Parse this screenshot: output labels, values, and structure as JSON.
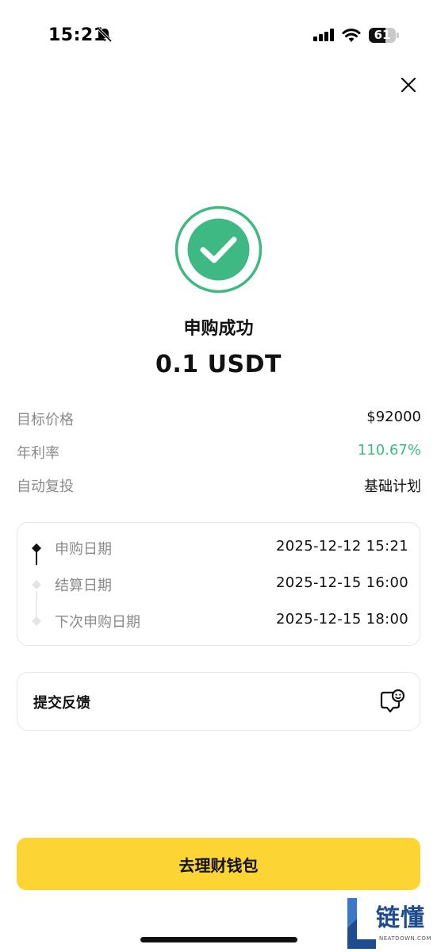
{
  "status_bar": {
    "time": "15:21",
    "battery_text": "61",
    "battery_level": 0.61,
    "icons": [
      "bell-slash-icon",
      "cellular-signal-icon",
      "wifi-icon",
      "battery-icon"
    ]
  },
  "header": {
    "close_icon": "close-icon"
  },
  "result": {
    "icon": "check-circle-icon",
    "title": "申购成功",
    "amount": "0.1 USDT"
  },
  "details": [
    {
      "label": "目标价格",
      "value": "$92000"
    },
    {
      "label": "年利率",
      "value": "110.67%"
    },
    {
      "label": "自动复投",
      "value": "基础计划"
    }
  ],
  "timeline": [
    {
      "label": "申购日期",
      "value": "2025-12-12 15:21",
      "active": true
    },
    {
      "label": "结算日期",
      "value": "2025-12-15 16:00",
      "active": false
    },
    {
      "label": "下次申购日期",
      "value": "2025-12-15 18:00",
      "active": false
    }
  ],
  "feedback": {
    "label": "提交反馈",
    "icon": "feedback-smile-icon"
  },
  "primary_button": {
    "label": "去理财钱包"
  },
  "watermark": {
    "text": "链懂",
    "sub": "NEATDOWN.COM"
  },
  "colors": {
    "accent_yellow": "#fcd535",
    "success_green": "#3fb983",
    "muted_text": "#8a8a8a"
  }
}
